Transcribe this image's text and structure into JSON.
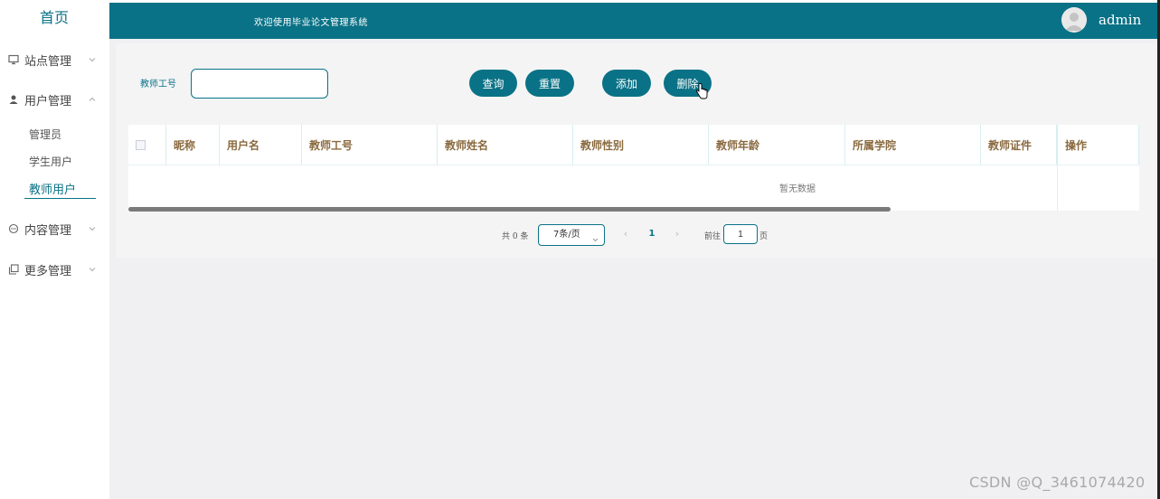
{
  "sidebar": {
    "home": "首页",
    "menus": [
      {
        "label": "站点管理",
        "icon": "monitor-icon"
      },
      {
        "label": "用户管理",
        "icon": "user-icon"
      },
      {
        "label": "内容管理",
        "icon": "chat-icon"
      },
      {
        "label": "更多管理",
        "icon": "copy-icon"
      }
    ],
    "user_submenu": [
      "管理员",
      "学生用户",
      "教师用户"
    ]
  },
  "header": {
    "welcome": "欢迎使用毕业论文管理系统",
    "username": "admin",
    "bg_color": "#0a7286"
  },
  "search": {
    "label": "教师工号",
    "value": "",
    "buttons": {
      "query": "查询",
      "reset": "重置",
      "add": "添加",
      "delete": "删除"
    }
  },
  "table": {
    "columns": [
      "昵称",
      "用户名",
      "教师工号",
      "教师姓名",
      "教师性别",
      "教师年龄",
      "所属学院",
      "教师证件",
      "操作"
    ],
    "rows": [],
    "empty_text": "暂无数据"
  },
  "pagination": {
    "total": "共 0 条",
    "page_size": "7条/页",
    "current_page": "1",
    "goto_label": "前往",
    "goto_value": "1",
    "page_suffix": "页",
    "prev": "‹",
    "next": "›"
  },
  "watermark": "CSDN @Q_3461074420"
}
